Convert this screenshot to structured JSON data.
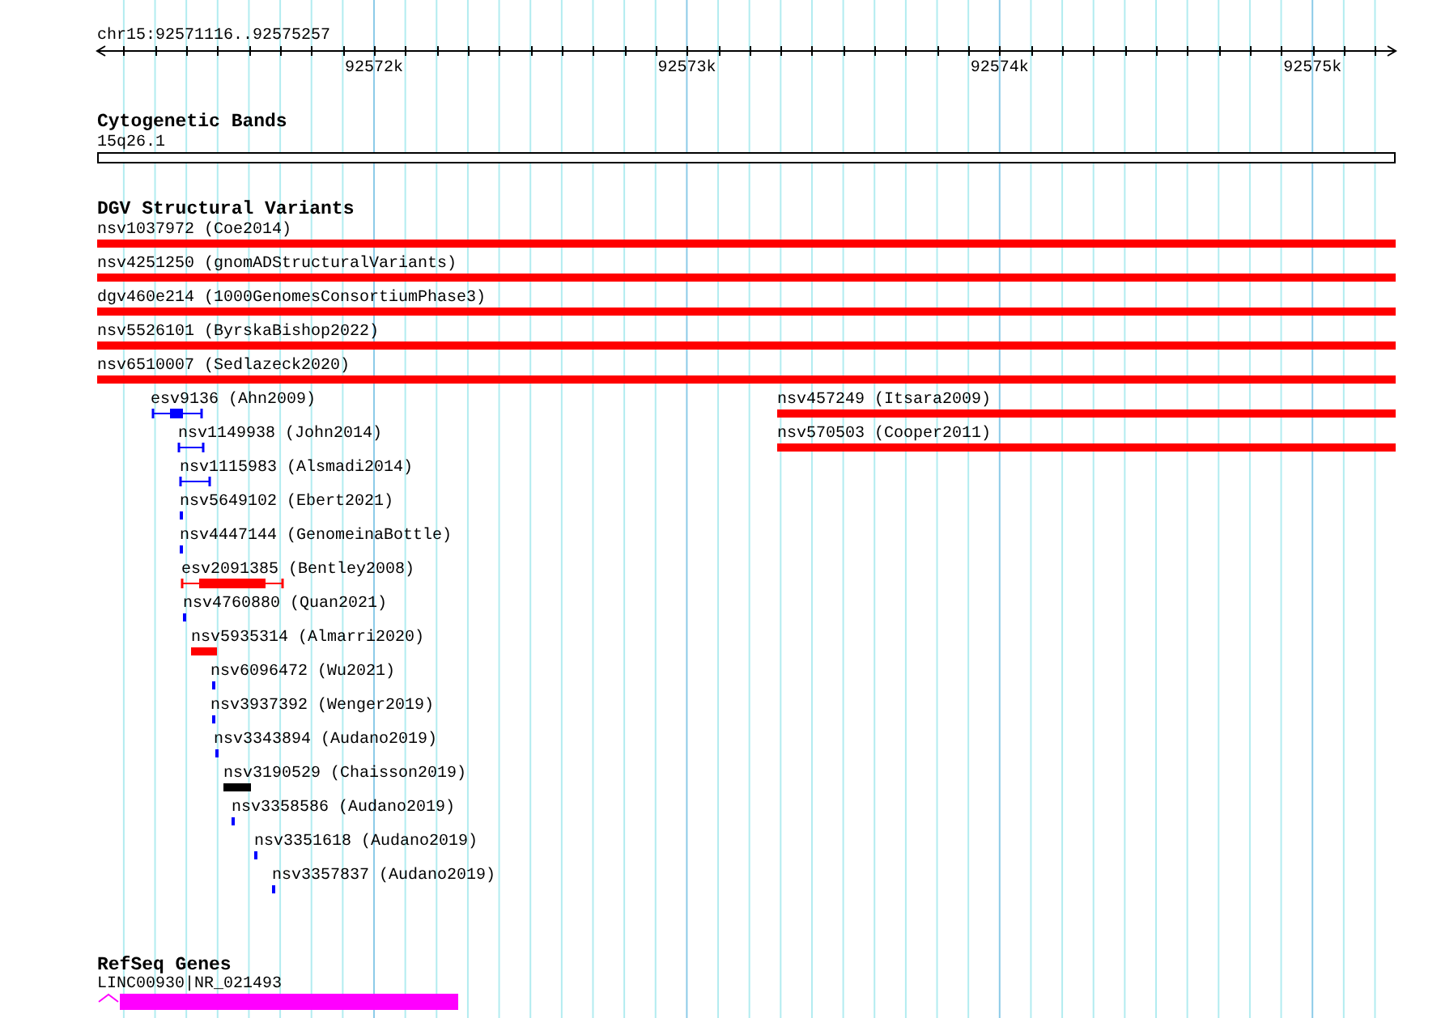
{
  "locus": "chr15:92571116..92575257",
  "ruler": {
    "ticks": [
      "92572k",
      "92573k",
      "92574k",
      "92575k"
    ]
  },
  "tracks": [
    {
      "title": "Cytogenetic Bands",
      "features": [
        {
          "label": "15q26.1",
          "kind": "band"
        }
      ]
    },
    {
      "title": "DGV Structural Variants",
      "features": [
        {
          "label": "nsv1037972 (Coe2014)",
          "kind": "bar",
          "color": "#ff0000"
        },
        {
          "label": "nsv4251250 (gnomADStructuralVariants)",
          "kind": "bar",
          "color": "#ff0000"
        },
        {
          "label": "dgv460e214 (1000GenomesConsortiumPhase3)",
          "kind": "bar",
          "color": "#ff0000"
        },
        {
          "label": "nsv5526101 (ByrskaBishop2022)",
          "kind": "bar",
          "color": "#ff0000"
        },
        {
          "label": "nsv6510007 (Sedlazeck2020)",
          "kind": "bar",
          "color": "#ff0000"
        },
        {
          "label": "esv9136 (Ahn2009)",
          "kind": "span",
          "color": "#0000ff"
        },
        {
          "label": "nsv457249 (Itsara2009)",
          "kind": "bar",
          "color": "#ff0000"
        },
        {
          "label": "nsv1149938 (John2014)",
          "kind": "span",
          "color": "#0000ff"
        },
        {
          "label": "nsv570503 (Cooper2011)",
          "kind": "bar",
          "color": "#ff0000"
        },
        {
          "label": "nsv1115983 (Alsmadi2014)",
          "kind": "span",
          "color": "#0000ff"
        },
        {
          "label": "nsv5649102 (Ebert2021)",
          "kind": "bar",
          "color": "#0000ff"
        },
        {
          "label": "nsv4447144 (GenomeinaBottle)",
          "kind": "bar",
          "color": "#0000ff"
        },
        {
          "label": "esv2091385 (Bentley2008)",
          "kind": "span",
          "color": "#ff0000"
        },
        {
          "label": "nsv4760880 (Quan2021)",
          "kind": "bar",
          "color": "#0000ff"
        },
        {
          "label": "nsv5935314 (Almarri2020)",
          "kind": "bar",
          "color": "#ff0000"
        },
        {
          "label": "nsv6096472 (Wu2021)",
          "kind": "bar",
          "color": "#0000ff"
        },
        {
          "label": "nsv3937392 (Wenger2019)",
          "kind": "bar",
          "color": "#0000ff"
        },
        {
          "label": "nsv3343894 (Audano2019)",
          "kind": "bar",
          "color": "#0000ff"
        },
        {
          "label": "nsv3190529 (Chaisson2019)",
          "kind": "bar",
          "color": "#000000"
        },
        {
          "label": "nsv3358586 (Audano2019)",
          "kind": "bar",
          "color": "#0000ff"
        },
        {
          "label": "nsv3351618 (Audano2019)",
          "kind": "bar",
          "color": "#0000ff"
        },
        {
          "label": "nsv3357837 (Audano2019)",
          "kind": "bar",
          "color": "#0000ff"
        }
      ]
    },
    {
      "title": "RefSeq Genes",
      "features": [
        {
          "label": "LINC00930|NR_021493",
          "kind": "gene",
          "color": "#ff00ff"
        }
      ]
    }
  ]
}
